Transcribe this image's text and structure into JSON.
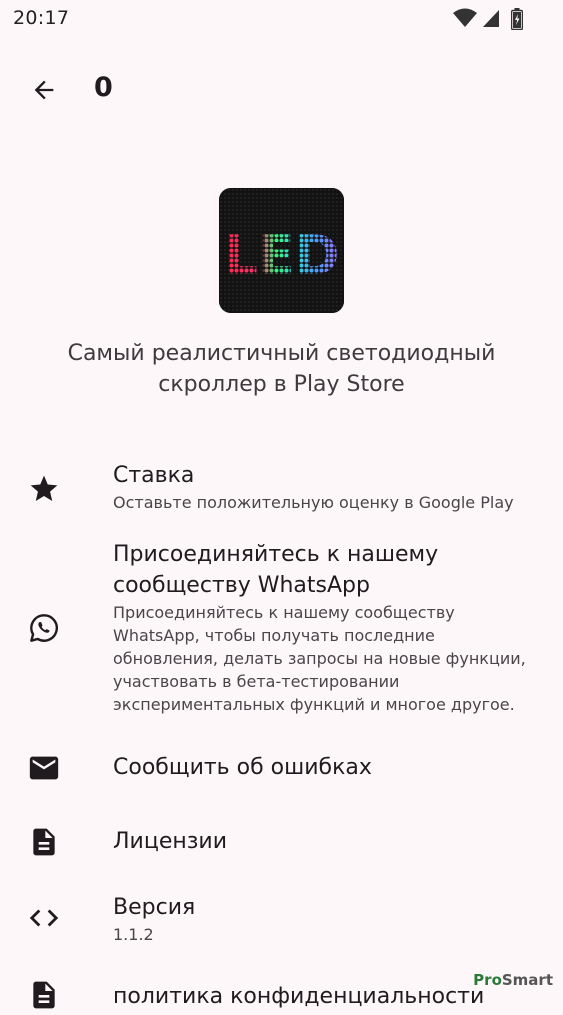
{
  "status_bar": {
    "time": "20:17"
  },
  "header": {
    "title": "0"
  },
  "app_logo": {
    "text": "LED"
  },
  "tagline": "Самый реалистичный светодиодный скроллер в Play Store",
  "menu": {
    "rate": {
      "title": "Ставка",
      "subtitle": "Оставьте положительную оценку в Google Play",
      "icon": "star-icon"
    },
    "whatsapp": {
      "title": "Присоединяйтесь к нашему сообществу WhatsApp",
      "subtitle": "Присоединяйтесь к нашему сообществу WhatsApp, чтобы получать последние обновления, делать запросы на новые функции, участвовать в бета-тестировании экспериментальных функций и многое другое.",
      "icon": "whatsapp-icon"
    },
    "report": {
      "title": "Сообщить об ошибках",
      "icon": "mail-icon"
    },
    "licenses": {
      "title": "Лицензии",
      "icon": "document-icon"
    },
    "version": {
      "title": "Версия",
      "subtitle": "1.1.2",
      "icon": "code-icon"
    },
    "privacy": {
      "title": "политика конфиденциальности",
      "icon": "document-icon"
    }
  },
  "watermark": {
    "part1": "Pro",
    "part2": "Smart"
  }
}
